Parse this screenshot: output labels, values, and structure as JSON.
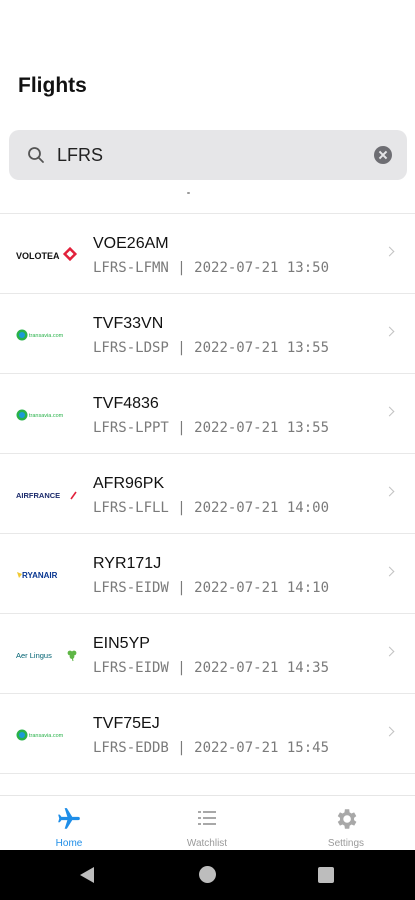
{
  "header": {
    "title": "Flights"
  },
  "search": {
    "value": "LFRS",
    "placeholder": ""
  },
  "flights": [
    {
      "callsign": "VOE26AM",
      "route": "LFRS-LFMN",
      "time": "2022-07-21 13:50",
      "airline": "Volotea",
      "logo_text": "VOLOTEA"
    },
    {
      "callsign": "TVF33VN",
      "route": "LFRS-LDSP",
      "time": "2022-07-21 13:55",
      "airline": "Transavia",
      "logo_text": "transavia.com"
    },
    {
      "callsign": "TVF4836",
      "route": "LFRS-LPPT",
      "time": "2022-07-21 13:55",
      "airline": "Transavia",
      "logo_text": "transavia.com"
    },
    {
      "callsign": "AFR96PK",
      "route": "LFRS-LFLL",
      "time": "2022-07-21 14:00",
      "airline": "Air France",
      "logo_text": "AIRFRANCE"
    },
    {
      "callsign": "RYR171J",
      "route": "LFRS-EIDW",
      "time": "2022-07-21 14:10",
      "airline": "Ryanair",
      "logo_text": "RYANAIR"
    },
    {
      "callsign": "EIN5YP",
      "route": "LFRS-EIDW",
      "time": "2022-07-21 14:35",
      "airline": "Aer Lingus",
      "logo_text": "Aer Lingus"
    },
    {
      "callsign": "TVF75EJ",
      "route": "LFRS-EDDB",
      "time": "2022-07-21 15:45",
      "airline": "Transavia",
      "logo_text": "transavia.com"
    }
  ],
  "tabs": [
    {
      "label": "Home",
      "icon": "airplane-icon",
      "active": true
    },
    {
      "label": "Watchlist",
      "icon": "list-icon",
      "active": false
    },
    {
      "label": "Settings",
      "icon": "gear-icon",
      "active": false
    }
  ],
  "colors": {
    "accent": "#1f8ee8",
    "search_bg": "#e6e6e8",
    "meta_text": "#7a7a7a"
  }
}
